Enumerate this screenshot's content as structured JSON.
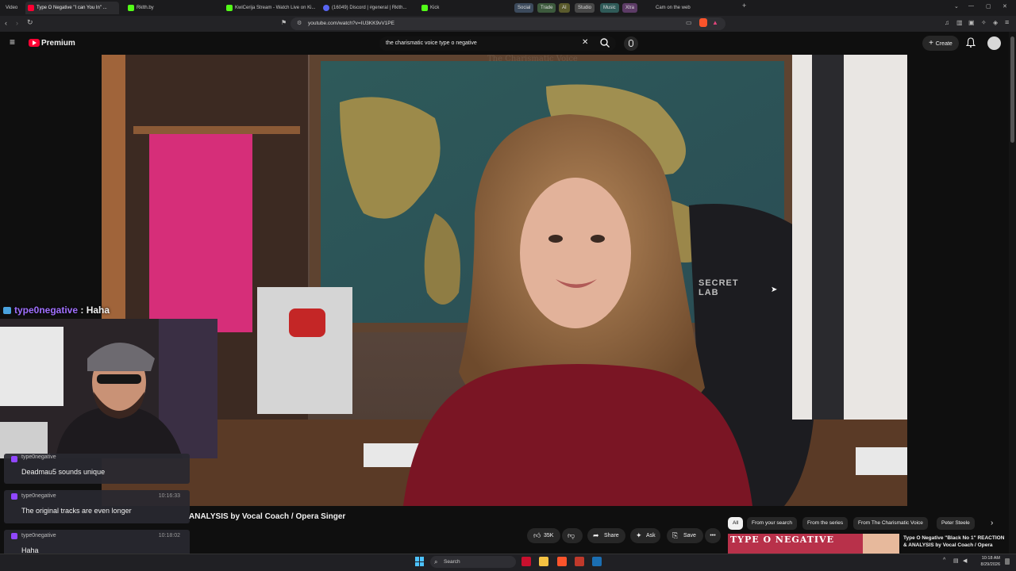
{
  "browser": {
    "tabs": [
      {
        "label": "Video",
        "color": "#d65bd6"
      },
      {
        "label": "Type O Negative \"I can You In\" ...",
        "color": "#ff0033"
      },
      {
        "label": "Rklth.by",
        "color": "#53fc18"
      },
      {
        "label": "KwiCerija Stream - Watch Live on Ki...",
        "color": "#53fc18"
      },
      {
        "label": "(16049) Discord | #general | Rklth...",
        "color": "#5865f2"
      },
      {
        "label": "Kick",
        "color": "#53fc18"
      }
    ],
    "groups": [
      "Social",
      "Trade",
      "AI",
      "Studio",
      "Music",
      "Xtra"
    ],
    "extra_tab": "Cam on the web",
    "url": "youtube.com/watch?v=IU3KK9vV1PE"
  },
  "youtube": {
    "logo_text": "Premium",
    "search_value": "the charismatic voice type o negative",
    "create_label": "Create",
    "video_title": "ANALYSIS by Vocal Coach / Opera Singer",
    "likes": "35K",
    "share_label": "Share",
    "ask_label": "Ask",
    "save_label": "Save",
    "chips": [
      "All",
      "From your search",
      "From the series",
      "From The Charismatic Voice",
      "Peter Steele"
    ],
    "rec_thumb_text": "TYPE O NEGATIVE",
    "rec_title": "Type O Negative \"Black No 1\" REACTION & ANALYSIS by Vocal Coach / Opera",
    "video_sign": "The Charismatic Voice",
    "chair_text": "SECRET LAB"
  },
  "overlay": {
    "header_user": "type0negative",
    "header_text": " : Haha",
    "messages": [
      {
        "user": "type0negative",
        "time": "",
        "text": "Deadmau5 sounds unique"
      },
      {
        "user": "type0negative",
        "time": "10:16:33",
        "text": "The original tracks are even longer"
      },
      {
        "user": "type0negative",
        "time": "10:18:02",
        "text": "Haha"
      }
    ]
  },
  "taskbar": {
    "search_label": "Search",
    "time": "10:18 AM",
    "date": "8/29/2026"
  }
}
